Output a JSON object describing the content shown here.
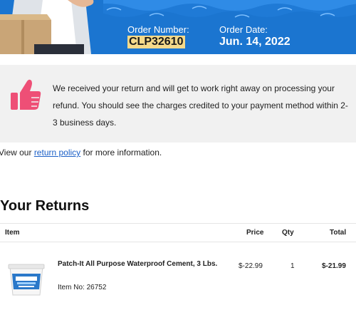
{
  "header": {
    "order_number_label": "Order Number:",
    "order_number_value": "CLP32610",
    "order_date_label": "Order Date:",
    "order_date_value": "Jun. 14, 2022"
  },
  "notice": {
    "icon": "thumbs-up-icon",
    "text": "We received your return and will get to work right away on processing your refund. You should see the charges credited to your payment method within 2-3 business days."
  },
  "policy": {
    "prefix": "View our ",
    "link_label": "return policy",
    "suffix": " for more information."
  },
  "returns": {
    "title": "Your Returns",
    "columns": {
      "item": "Item",
      "price": "Price",
      "qty": "Qty",
      "total": "Total"
    },
    "items": [
      {
        "name": "Patch-It All Purpose Waterproof Cement, 3 Lbs.",
        "sku": "Item No: 26752",
        "price": "$-22.99",
        "qty": "1",
        "total": "$-21.99"
      }
    ]
  },
  "colors": {
    "header_blue": "#1b75d0",
    "highlight": "#f4d98a",
    "thumb_pink": "#ee4f76",
    "link": "#1b5fc7"
  }
}
